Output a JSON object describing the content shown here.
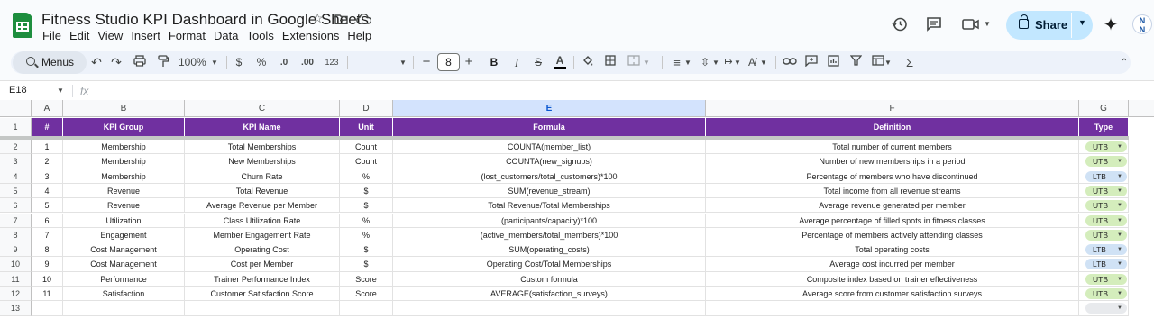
{
  "doc": {
    "title": "Fitness Studio KPI Dashboard in Google Sheets"
  },
  "menu": [
    "File",
    "Edit",
    "View",
    "Insert",
    "Format",
    "Data",
    "Tools",
    "Extensions",
    "Help"
  ],
  "share": {
    "label": "Share"
  },
  "avatar": {
    "initials": "N\nN"
  },
  "toolbar": {
    "search_label": "Menus",
    "zoom": "100%",
    "currency": "$",
    "percent": "%",
    "decrease_decimal": ".0",
    "increase_decimal": ".00",
    "number_format": "123",
    "font_size": "8",
    "bold": "B",
    "italic": "I",
    "sum": "Σ"
  },
  "formula_bar": {
    "cell_ref": "E18",
    "fx": "fx",
    "value": ""
  },
  "columns": [
    "A",
    "B",
    "C",
    "D",
    "E",
    "F",
    "G"
  ],
  "selected_column": "E",
  "header_row": {
    "num": "1",
    "cells": [
      "#",
      "KPI Group",
      "KPI Name",
      "Unit",
      "Formula",
      "Definition",
      "Type"
    ]
  },
  "rows": [
    {
      "num": "2",
      "cells": [
        "1",
        "Membership",
        "Total Memberships",
        "Count",
        "COUNTA(member_list)",
        "Total number of current members"
      ],
      "type": "UTB"
    },
    {
      "num": "3",
      "cells": [
        "2",
        "Membership",
        "New Memberships",
        "Count",
        "COUNTA(new_signups)",
        "Number of new memberships in a period"
      ],
      "type": "UTB"
    },
    {
      "num": "4",
      "cells": [
        "3",
        "Membership",
        "Churn Rate",
        "%",
        "(lost_customers/total_customers)*100",
        "Percentage of members who have discontinued"
      ],
      "type": "LTB"
    },
    {
      "num": "5",
      "cells": [
        "4",
        "Revenue",
        "Total Revenue",
        "$",
        "SUM(revenue_stream)",
        "Total income from all revenue streams"
      ],
      "type": "UTB"
    },
    {
      "num": "6",
      "cells": [
        "5",
        "Revenue",
        "Average Revenue per Member",
        "$",
        "Total Revenue/Total Memberships",
        "Average revenue generated per member"
      ],
      "type": "UTB"
    },
    {
      "num": "7",
      "cells": [
        "6",
        "Utilization",
        "Class Utilization Rate",
        "%",
        "(participants/capacity)*100",
        "Average percentage of filled spots in fitness classes"
      ],
      "type": "UTB"
    },
    {
      "num": "8",
      "cells": [
        "7",
        "Engagement",
        "Member Engagement Rate",
        "%",
        "(active_members/total_members)*100",
        "Percentage of members actively attending classes"
      ],
      "type": "UTB"
    },
    {
      "num": "9",
      "cells": [
        "8",
        "Cost Management",
        "Operating Cost",
        "$",
        "SUM(operating_costs)",
        "Total operating costs"
      ],
      "type": "LTB"
    },
    {
      "num": "10",
      "cells": [
        "9",
        "Cost Management",
        "Cost per Member",
        "$",
        "Operating Cost/Total Memberships",
        "Average cost incurred per member"
      ],
      "type": "LTB"
    },
    {
      "num": "11",
      "cells": [
        "10",
        "Performance",
        "Trainer Performance Index",
        "Score",
        "Custom formula",
        "Composite index based on trainer effectiveness"
      ],
      "type": "UTB"
    },
    {
      "num": "12",
      "cells": [
        "11",
        "Satisfaction",
        "Customer Satisfaction Score",
        "Score",
        "AVERAGE(satisfaction_surveys)",
        "Average score from customer satisfaction surveys"
      ],
      "type": "UTB"
    },
    {
      "num": "13",
      "cells": [
        "",
        "",
        "",
        "",
        "",
        ""
      ],
      "type": ""
    }
  ],
  "colors": {
    "header_purple": "#7030a0",
    "utb_chip": "#d4edbc",
    "ltb_chip": "#d0e2f5",
    "empty_chip": "#e8eaed",
    "share_bg": "#c2e7ff"
  }
}
